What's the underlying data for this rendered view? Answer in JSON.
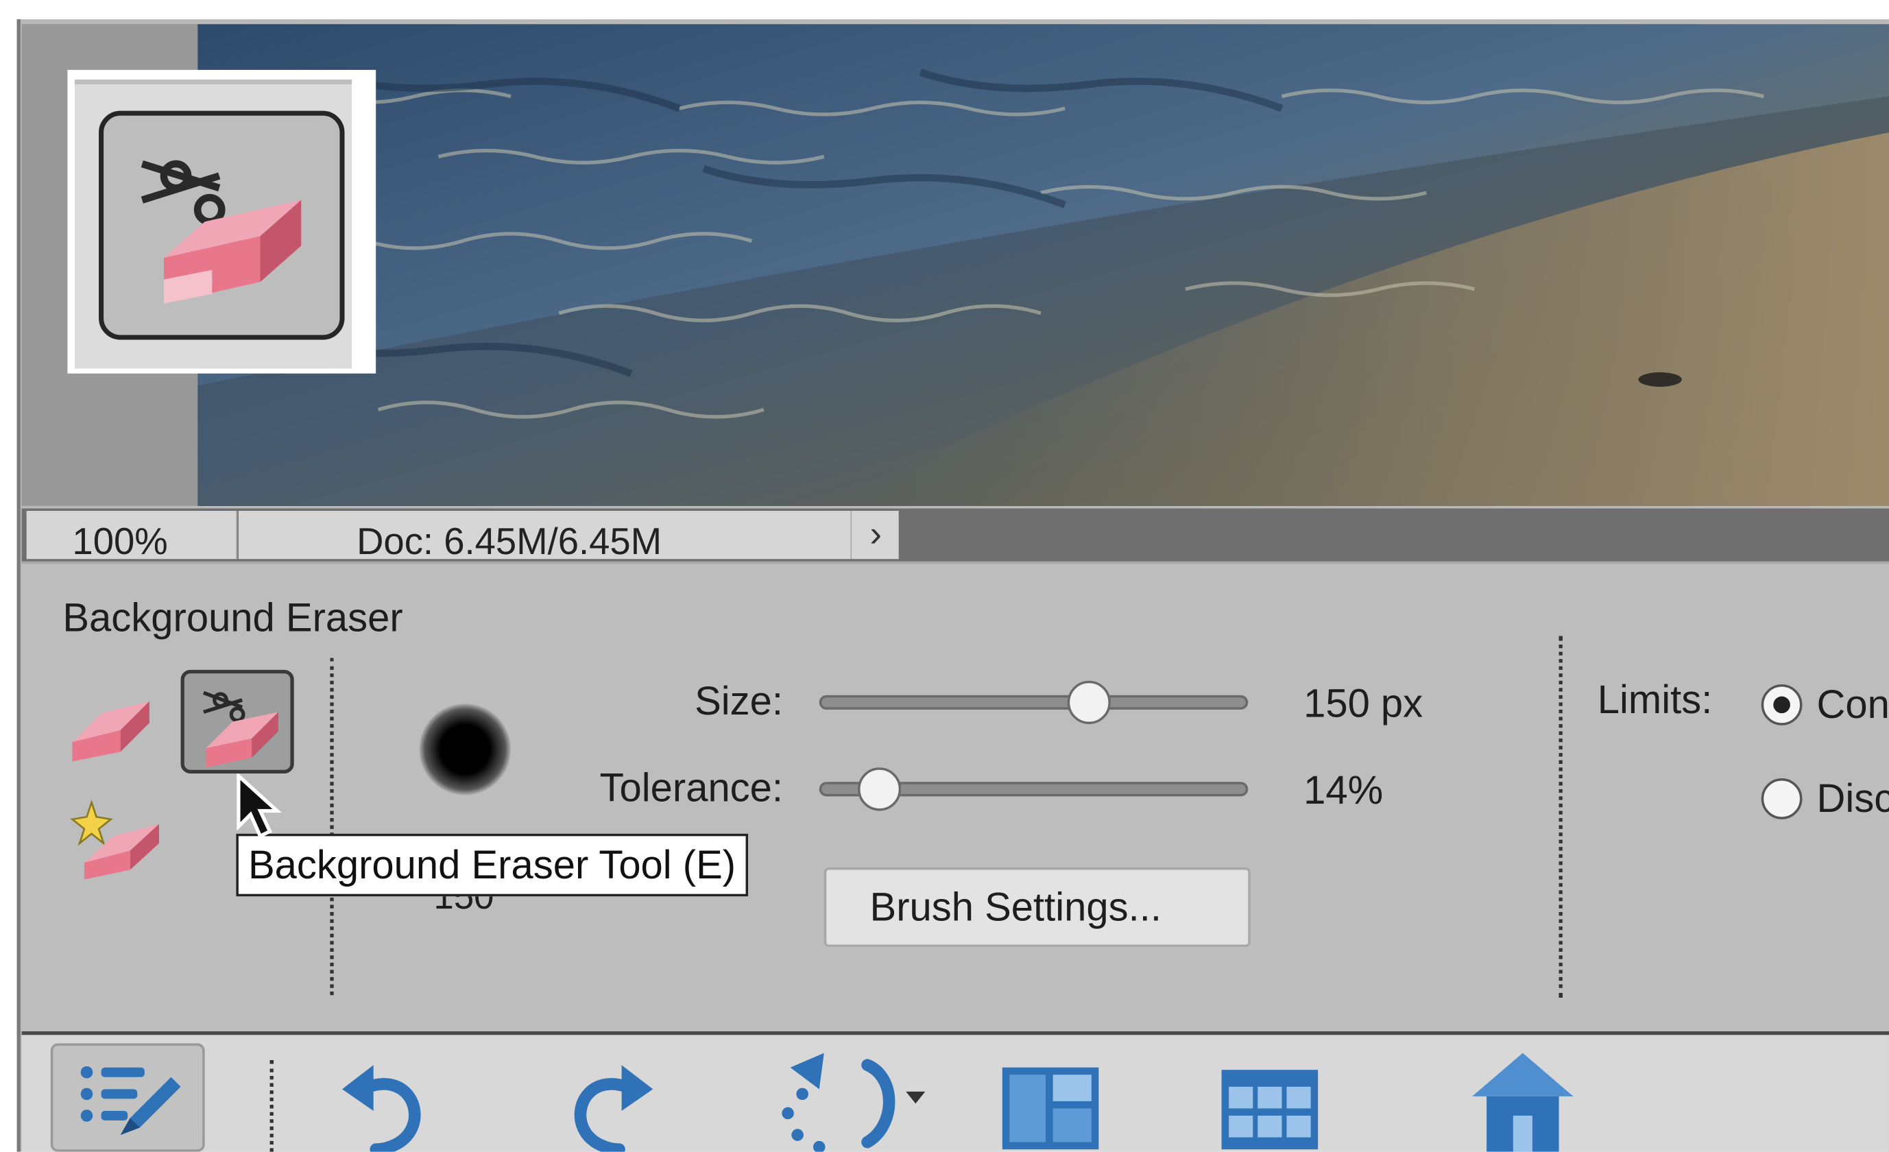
{
  "status_bar": {
    "zoom": "100%",
    "doc_info": "Doc: 6.45M/6.45M",
    "arrow": "›"
  },
  "tool_options": {
    "title": "Background Eraser",
    "brush_size_value_partial": "150",
    "size": {
      "label": "Size:",
      "value": "150 px",
      "level": 0.63
    },
    "tolerance": {
      "label": "Tolerance:",
      "value": "14%",
      "level": 0.14
    },
    "brush_settings_label": "Brush Settings...",
    "limits": {
      "label": "Limits:",
      "options": [
        {
          "label": "Contiguous",
          "visible_text": "Con",
          "selected": true
        },
        {
          "label": "Discontiguous",
          "visible_text": "Disc",
          "selected": false
        }
      ]
    }
  },
  "tooltip": {
    "text": "Background Eraser Tool (E)"
  },
  "colors": {
    "panel_bg": "#bdbdbd",
    "eraser_pink": "#e8778c",
    "icon_blue": "#2f72b8",
    "tooltip_bg": "#ffffff"
  },
  "icons": {
    "thumbnail": "background-eraser-icon",
    "tools": [
      "eraser-icon",
      "background-eraser-icon",
      "magic-eraser-icon"
    ],
    "bottom_bar": [
      "tool-options-icon",
      "undo-icon",
      "redo-icon",
      "rotate-icon",
      "layout-icon",
      "organizer-icon",
      "home-icon"
    ]
  }
}
